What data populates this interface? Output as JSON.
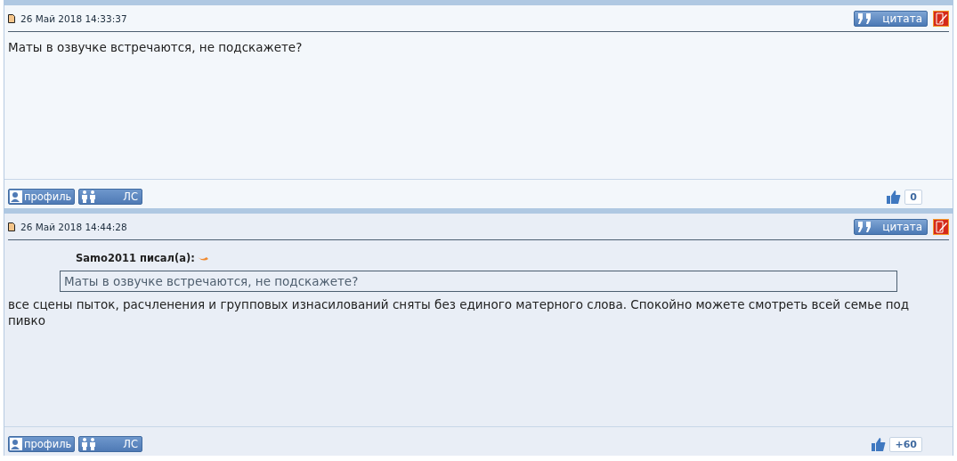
{
  "posts": [
    {
      "date": "26 Май 2018 14:33:37",
      "quote_button": "цитата",
      "body": "Маты в озвучке встречаются, не подскажете?",
      "profile_button": "профиль",
      "pm_button": "ЛС",
      "rating": "0"
    },
    {
      "date": "26 Май 2018 14:44:28",
      "quote_button": "цитата",
      "quote": {
        "author": "Samo2011 писал(а):",
        "text": "Маты в озвучке встречаются, не подскажете?"
      },
      "body": "все сцены пыток, расчленения и групповых изнасилований сняты без единого матерного слова. Спокойно можете смотреть всей семье под пивко",
      "profile_button": "профиль",
      "pm_button": "ЛС",
      "rating": "+60"
    }
  ]
}
